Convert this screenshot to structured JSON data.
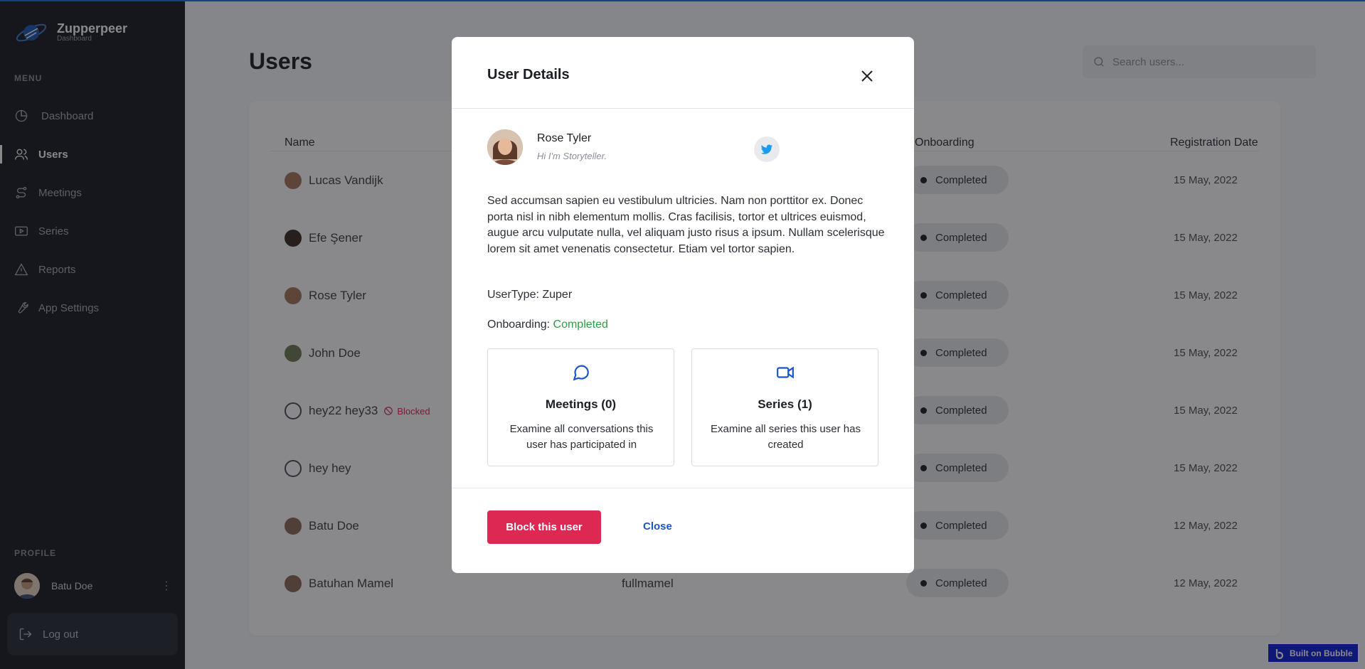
{
  "brand": {
    "name": "Zupperpeer",
    "sub": "Dashboard"
  },
  "sidebar": {
    "menu_label": "MENU",
    "items": [
      {
        "label": "Dashboard",
        "icon": "pie-chart-icon"
      },
      {
        "label": "Users",
        "icon": "users-icon",
        "active": true
      },
      {
        "label": "Meetings",
        "icon": "route-icon"
      },
      {
        "label": "Series",
        "icon": "video-icon"
      },
      {
        "label": "Reports",
        "icon": "alert-triangle-icon"
      },
      {
        "label": "App Settings",
        "icon": "wrench-icon"
      }
    ],
    "profile_label": "PROFILE",
    "profile_name": "Batu Doe",
    "logout_label": "Log out"
  },
  "page": {
    "title": "Users",
    "search_placeholder": "Search users..."
  },
  "table": {
    "headers": {
      "name": "Name",
      "onboarding": "Onboarding",
      "registration": "Registration Date"
    },
    "rows": [
      {
        "name": "Lucas Vandijk",
        "status": "Completed",
        "date": "15 May, 2022"
      },
      {
        "name": "Efe Şener",
        "status": "Completed",
        "date": "15 May, 2022"
      },
      {
        "name": "Rose Tyler",
        "status": "Completed",
        "date": "15 May, 2022"
      },
      {
        "name": "John Doe",
        "status": "Completed",
        "date": "15 May, 2022"
      },
      {
        "name": "hey22 hey33",
        "blocked": "Blocked",
        "status": "Completed",
        "date": "15 May, 2022"
      },
      {
        "name": "hey hey",
        "status": "Completed",
        "date": "15 May, 2022"
      },
      {
        "name": "Batu Doe",
        "status": "Completed",
        "date": "12 May, 2022"
      },
      {
        "name": "Batuhan Mamel",
        "username": "fullmamel",
        "status": "Completed",
        "date": "12 May, 2022"
      }
    ]
  },
  "modal": {
    "title": "User Details",
    "user_name": "Rose Tyler",
    "bio": "Hi I'm Storyteller.",
    "description": "Sed accumsan sapien eu vestibulum ultricies. Nam non porttitor ex. Donec porta nisl in nibh elementum mollis. Cras facilisis, tortor et ultrices euismod, augue arcu vulputate nulla, vel aliquam justo risus a ipsum. Nullam scelerisque lorem sit amet venenatis consectetur. Etiam vel tortor sapien.",
    "usertype": "UserType: Zuper",
    "onboarding_label": "Onboarding: ",
    "onboarding_value": "Completed",
    "meetings_title": "Meetings (0)",
    "meetings_desc": "Examine all conversations this user has participated in",
    "series_title": "Series (1)",
    "series_desc": "Examine all series this user has created",
    "block_label": "Block this user",
    "close_label": "Close"
  },
  "badge": {
    "built_on": "Built on Bubble"
  },
  "colors": {
    "accent": "#1a56c8",
    "danger": "#dc2853",
    "success": "#2e9e44",
    "sidebar": "#171b23"
  }
}
